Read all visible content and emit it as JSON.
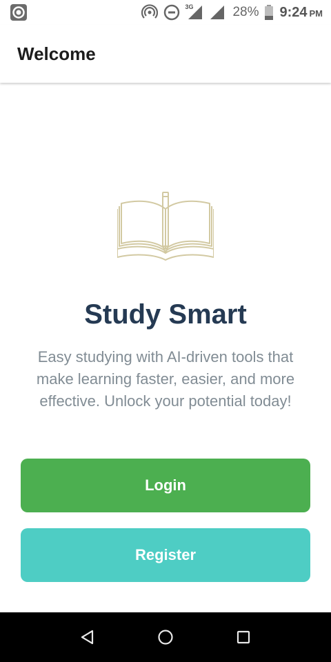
{
  "status_bar": {
    "battery": "28%",
    "time": "9:24",
    "ampm": "PM",
    "network": "3G",
    "icons": [
      "app-notification-icon",
      "hotspot-icon",
      "do-not-disturb-icon",
      "signal-icon",
      "signal-icon",
      "battery-icon"
    ]
  },
  "app_bar": {
    "title": "Welcome"
  },
  "hero": {
    "illustration": "open-book-icon",
    "title": "Study Smart",
    "description": "Easy studying with AI-driven tools that make learning faster, easier, and more effective. Unlock your potential today!"
  },
  "actions": {
    "login_label": "Login",
    "register_label": "Register"
  },
  "nav_bar": {
    "icons": [
      "back-icon",
      "home-icon",
      "recents-icon"
    ]
  },
  "colors": {
    "login": "#4caf50",
    "register": "#4ecdc4",
    "title": "#253a53",
    "description": "#818c94",
    "illustration": "#d2c9a2"
  }
}
